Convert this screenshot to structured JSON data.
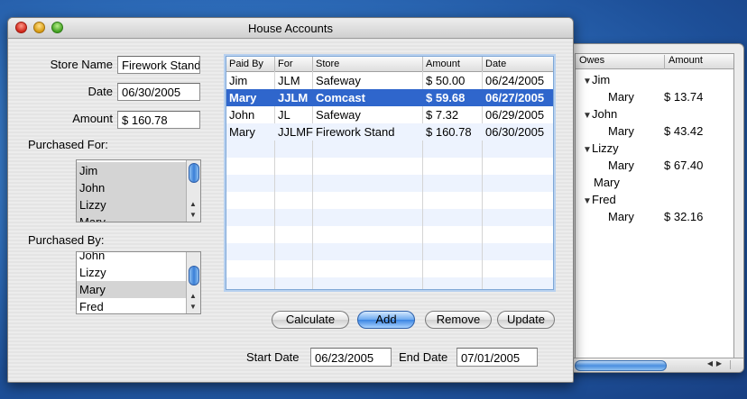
{
  "window": {
    "title": "House Accounts"
  },
  "form": {
    "store_label": "Store Name",
    "store_value": "Firework Stand",
    "date_label": "Date",
    "date_value": "06/30/2005",
    "amount_label": "Amount",
    "amount_value": "$ 160.78",
    "purchased_for_label": "Purchased For:",
    "purchased_for_items": [
      {
        "label": "Jim",
        "selected": true
      },
      {
        "label": "John",
        "selected": true
      },
      {
        "label": "Lizzy",
        "selected": true
      },
      {
        "label": "Mary",
        "selected": true
      }
    ],
    "purchased_by_label": "Purchased By:",
    "purchased_by_items": [
      {
        "label": "John",
        "selected": false
      },
      {
        "label": "Lizzy",
        "selected": false
      },
      {
        "label": "Mary",
        "selected": true
      },
      {
        "label": "Fred",
        "selected": false
      }
    ]
  },
  "table": {
    "columns": [
      "Paid By",
      "For",
      "Store",
      "Amount",
      "Date"
    ],
    "rows": [
      {
        "cells": [
          "Jim",
          "JLM",
          "Safeway",
          "$ 50.00",
          "06/24/2005"
        ],
        "selected": false
      },
      {
        "cells": [
          "Mary",
          "JJLM",
          "Comcast",
          "$ 59.68",
          "06/27/2005"
        ],
        "selected": true
      },
      {
        "cells": [
          "John",
          "JL",
          "Safeway",
          "$ 7.32",
          "06/29/2005"
        ],
        "selected": false
      },
      {
        "cells": [
          "Mary",
          "JJLMF",
          "Firework Stand",
          "$ 160.78",
          "06/30/2005"
        ],
        "selected": false
      }
    ]
  },
  "buttons": {
    "calculate": "Calculate",
    "add": "Add",
    "remove": "Remove",
    "update": "Update"
  },
  "range": {
    "start_label": "Start Date",
    "start_value": "06/23/2005",
    "end_label": "End Date",
    "end_value": "07/01/2005"
  },
  "owes_panel": {
    "columns": [
      "Owes",
      "Amount"
    ],
    "entries": [
      {
        "person": "Jim",
        "debtor": "Mary",
        "amount": "$ 13.74"
      },
      {
        "person": "John",
        "debtor": "Mary",
        "amount": "$ 43.42"
      },
      {
        "person": "Lizzy",
        "debtor": "Mary",
        "amount": "$ 67.40"
      },
      {
        "person": "Mary",
        "debtor": "",
        "amount": ""
      },
      {
        "person": "Fred",
        "debtor": "Mary",
        "amount": "$ 32.16"
      }
    ]
  },
  "colors": {
    "selection": "#2f66cc",
    "alt_row": "#edf3fe",
    "desktop": "#2f6fbd"
  }
}
